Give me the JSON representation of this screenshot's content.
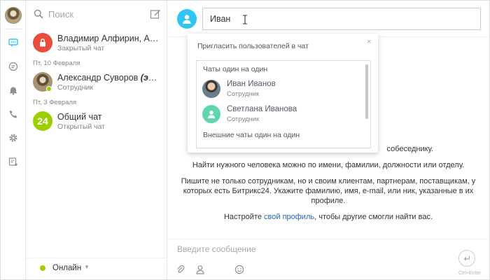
{
  "search": {
    "placeholder": "Поиск"
  },
  "recent": {
    "items": [
      {
        "name": "Владимир Алфирин, Алексей",
        "subtitle": "Закрытый чат",
        "avatar": "lock-icon",
        "color": "#e94e3d"
      },
      {
        "name": "Александр Суворов",
        "name_note": "(это вы)",
        "subtitle": "Сотрудник",
        "avatar": "photo",
        "online": true
      },
      {
        "name": "Общий чат",
        "subtitle": "Открытый чат",
        "avatar_text": "24",
        "color": "#9dcf00"
      }
    ],
    "dates": [
      "Пт, 10 Февраля",
      "Пт, 3 Февраля"
    ]
  },
  "status": {
    "label": "Онлайн",
    "color": "#9dcf00"
  },
  "dialog": {
    "input_value": "Иван",
    "hints": [
      "Найти нужного человека можно по имени, фамилии, должности или отделу.",
      "Пишите не только сотрудникам, но и своим клиентам, партнерам, поставщикам, у которых есть Битрикс24. Укажите фамилию, имя, e-mail, или ник, указанные в их профиле.",
      "собеседнику."
    ],
    "profile_hint_before": "Настройте ",
    "profile_link": "свой профиль",
    "profile_hint_after": ", чтобы другие смогли найти вас.",
    "message_placeholder": "Введите сообщение",
    "send_hint": "Ctrl+Enter"
  },
  "popup": {
    "title": "Пригласить пользователей в чат",
    "close": "×",
    "section_one": "Чаты один на один",
    "people": [
      {
        "name": "Иван Иванов",
        "role": "Сотрудник",
        "avatar": "photo"
      },
      {
        "name": "Светлана Иванова",
        "role": "Сотрудник",
        "avatar": "user-icon",
        "color": "#5fd6b0"
      }
    ],
    "section_external": "Внешние чаты один на один"
  },
  "colors": {
    "accent": "#2fc6f6",
    "link": "#2067b0",
    "online": "#9dcf00",
    "closed_chat": "#e94e3d"
  }
}
